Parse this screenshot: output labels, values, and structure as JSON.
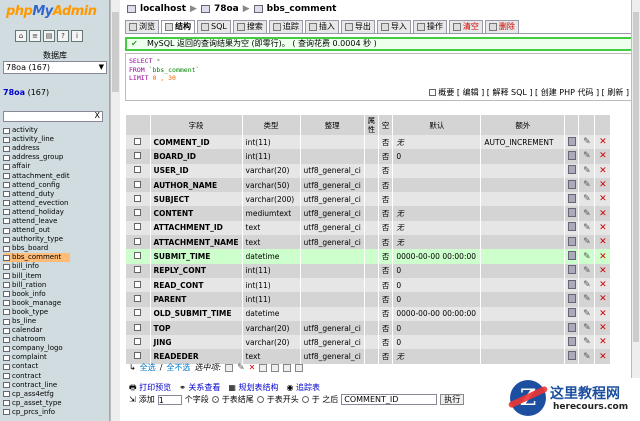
{
  "sidebar": {
    "logo_php": "php",
    "logo_my": "My",
    "logo_admin": "Admin",
    "db_label": "数据库",
    "db_select": "78oa (167)",
    "current_db": "78oa",
    "current_count": "(167)",
    "filter_clear": "X",
    "tables": [
      "activity",
      "activity_line",
      "address",
      "address_group",
      "affair",
      "attachment_edit",
      "attend_config",
      "attend_duty",
      "attend_evection",
      "attend_holiday",
      "attend_leave",
      "attend_out",
      "authority_type",
      "bbs_board",
      "bbs_comment",
      "bill_info",
      "bill_item",
      "bill_ration",
      "book_info",
      "book_manage",
      "book_type",
      "bs_line",
      "calendar",
      "chatroom",
      "company_logo",
      "complaint",
      "contact",
      "contract",
      "contract_line",
      "cp_ass4etfg",
      "cp_asset_type",
      "cp_prcs_info"
    ],
    "active_table": "bbs_comment"
  },
  "breadcrumb": {
    "server": "localhost",
    "database": "78oa",
    "table": "bbs_comment"
  },
  "tabs": [
    {
      "label": "浏览",
      "selected": false,
      "red": false
    },
    {
      "label": "结构",
      "selected": true,
      "red": false
    },
    {
      "label": "SQL",
      "selected": false,
      "red": false
    },
    {
      "label": "搜索",
      "selected": false,
      "red": false
    },
    {
      "label": "追踪",
      "selected": false,
      "red": false
    },
    {
      "label": "插入",
      "selected": false,
      "red": false
    },
    {
      "label": "导出",
      "selected": false,
      "red": false
    },
    {
      "label": "导入",
      "selected": false,
      "red": false
    },
    {
      "label": "操作",
      "selected": false,
      "red": false
    },
    {
      "label": "清空",
      "selected": false,
      "red": true
    },
    {
      "label": "删除",
      "selected": false,
      "red": true
    }
  ],
  "message": "MySQL 返回的查询结果为空 (即零行)。 ( 查询花费 0.0004 秒 )",
  "sql": {
    "select": "SELECT",
    "star": " *",
    "from": "FROM",
    "table": " `bbs_comment`",
    "limit": "LIMIT",
    "limit_vals": " 0 , 30",
    "links": "概要 [ 编辑 ] [ 解释 SQL ] [ 创建 PHP 代码 ] [ 刷新 ]"
  },
  "table_headers": [
    "字段",
    "类型",
    "整理",
    "属性",
    "空",
    "默认",
    "额外"
  ],
  "columns": [
    {
      "field": "COMMENT_ID",
      "type": "int(11)",
      "collation": "",
      "attr": "",
      "null": "否",
      "default": "无",
      "extra": "AUTO_INCREMENT"
    },
    {
      "field": "BOARD_ID",
      "type": "int(11)",
      "collation": "",
      "attr": "",
      "null": "否",
      "default": "0",
      "extra": ""
    },
    {
      "field": "USER_ID",
      "type": "varchar(20)",
      "collation": "utf8_general_ci",
      "attr": "",
      "null": "否",
      "default": "",
      "extra": ""
    },
    {
      "field": "AUTHOR_NAME",
      "type": "varchar(50)",
      "collation": "utf8_general_ci",
      "attr": "",
      "null": "否",
      "default": "",
      "extra": ""
    },
    {
      "field": "SUBJECT",
      "type": "varchar(200)",
      "collation": "utf8_general_ci",
      "attr": "",
      "null": "否",
      "default": "",
      "extra": ""
    },
    {
      "field": "CONTENT",
      "type": "mediumtext",
      "collation": "utf8_general_ci",
      "attr": "",
      "null": "否",
      "default": "无",
      "extra": ""
    },
    {
      "field": "ATTACHMENT_ID",
      "type": "text",
      "collation": "utf8_general_ci",
      "attr": "",
      "null": "否",
      "default": "无",
      "extra": ""
    },
    {
      "field": "ATTACHMENT_NAME",
      "type": "text",
      "collation": "utf8_general_ci",
      "attr": "",
      "null": "否",
      "default": "无",
      "extra": ""
    },
    {
      "field": "SUBMIT_TIME",
      "type": "datetime",
      "collation": "",
      "attr": "",
      "null": "否",
      "default": "0000-00-00 00:00:00",
      "extra": ""
    },
    {
      "field": "REPLY_CONT",
      "type": "int(11)",
      "collation": "",
      "attr": "",
      "null": "否",
      "default": "0",
      "extra": ""
    },
    {
      "field": "READ_CONT",
      "type": "int(11)",
      "collation": "",
      "attr": "",
      "null": "否",
      "default": "0",
      "extra": ""
    },
    {
      "field": "PARENT",
      "type": "int(11)",
      "collation": "",
      "attr": "",
      "null": "否",
      "default": "0",
      "extra": ""
    },
    {
      "field": "OLD_SUBMIT_TIME",
      "type": "datetime",
      "collation": "",
      "attr": "",
      "null": "否",
      "default": "0000-00-00 00:00:00",
      "extra": ""
    },
    {
      "field": "TOP",
      "type": "varchar(20)",
      "collation": "utf8_general_ci",
      "attr": "",
      "null": "否",
      "default": "0",
      "extra": ""
    },
    {
      "field": "JING",
      "type": "varchar(20)",
      "collation": "utf8_general_ci",
      "attr": "",
      "null": "否",
      "default": "0",
      "extra": ""
    },
    {
      "field": "READEDER",
      "type": "text",
      "collation": "utf8_general_ci",
      "attr": "",
      "null": "否",
      "default": "无",
      "extra": ""
    }
  ],
  "highlight_row": 8,
  "actions": {
    "check_all": "全选",
    "divider": "/",
    "uncheck_all": "全不选",
    "selected_label": "选中项:"
  },
  "footer": {
    "print": "打印预览",
    "relations": "关系查看",
    "propose": "规划表结构",
    "track": "追踪表",
    "add": "添加",
    "add_count": "1",
    "fields_label": "个字段",
    "at_end": "于表结尾",
    "at_begin": "于表开头",
    "after": "于 之后",
    "after_field": "COMMENT_ID",
    "go": "执行"
  },
  "watermark": {
    "logo_letter": "Z",
    "title": "这里教程网",
    "url": "herecours.com"
  }
}
